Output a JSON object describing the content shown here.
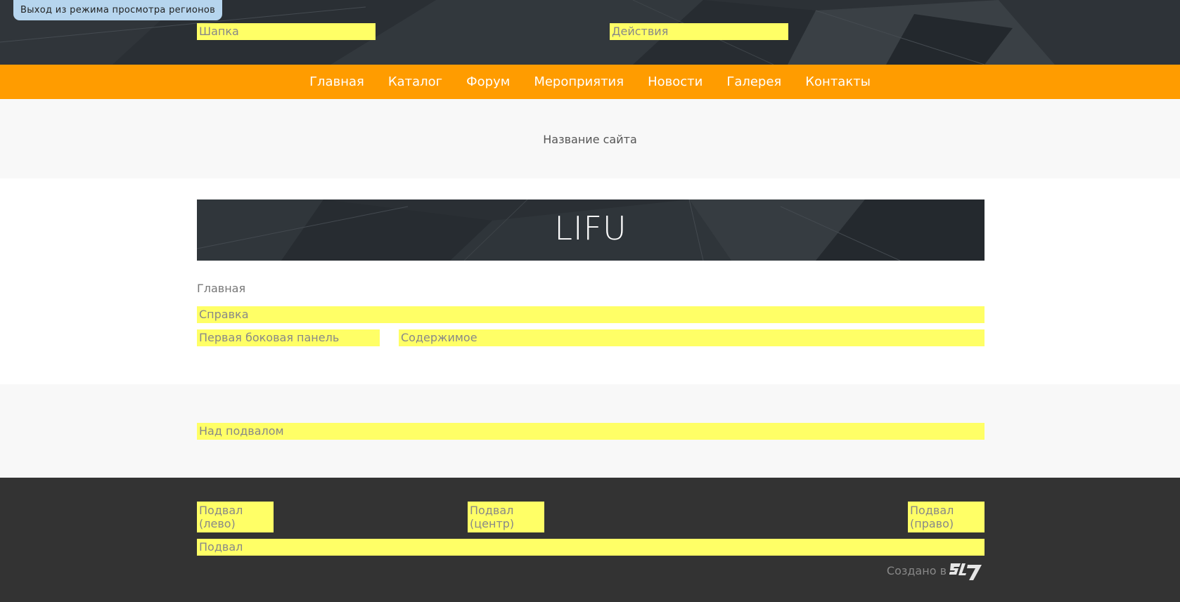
{
  "admin": {
    "exit_regions_label": "Выход из режима просмотра регионов"
  },
  "regions": {
    "header": "Шапка",
    "actions": "Действия",
    "help": "Справка",
    "sidebar_first": "Первая боковая панель",
    "content": "Содержимое",
    "above_footer": "Над подвалом",
    "footer_left_line1": "Подвал",
    "footer_left_line2": "(лево)",
    "footer_center_line1": "Подвал",
    "footer_center_line2": "(центр)",
    "footer_right_line1": "Подвал",
    "footer_right_line2": "(право)",
    "footer": "Подвал"
  },
  "nav": {
    "items": [
      {
        "label": "Главная"
      },
      {
        "label": "Каталог"
      },
      {
        "label": "Форум"
      },
      {
        "label": "Мероприятия"
      },
      {
        "label": "Новости"
      },
      {
        "label": "Галерея"
      },
      {
        "label": "Контакты"
      }
    ]
  },
  "site": {
    "name": "Название сайта"
  },
  "banner": {
    "title": "LIFU"
  },
  "breadcrumb": {
    "home": "Главная"
  },
  "footer": {
    "created_in": "Создано в",
    "logo_icon": "s17-logo-icon"
  },
  "colors": {
    "header_bg": "#2c3136",
    "nav_bg": "#ff9c00",
    "region_highlight": "#ffff66",
    "footer_bg": "#333333",
    "admin_tab": "#b6d5ee"
  }
}
